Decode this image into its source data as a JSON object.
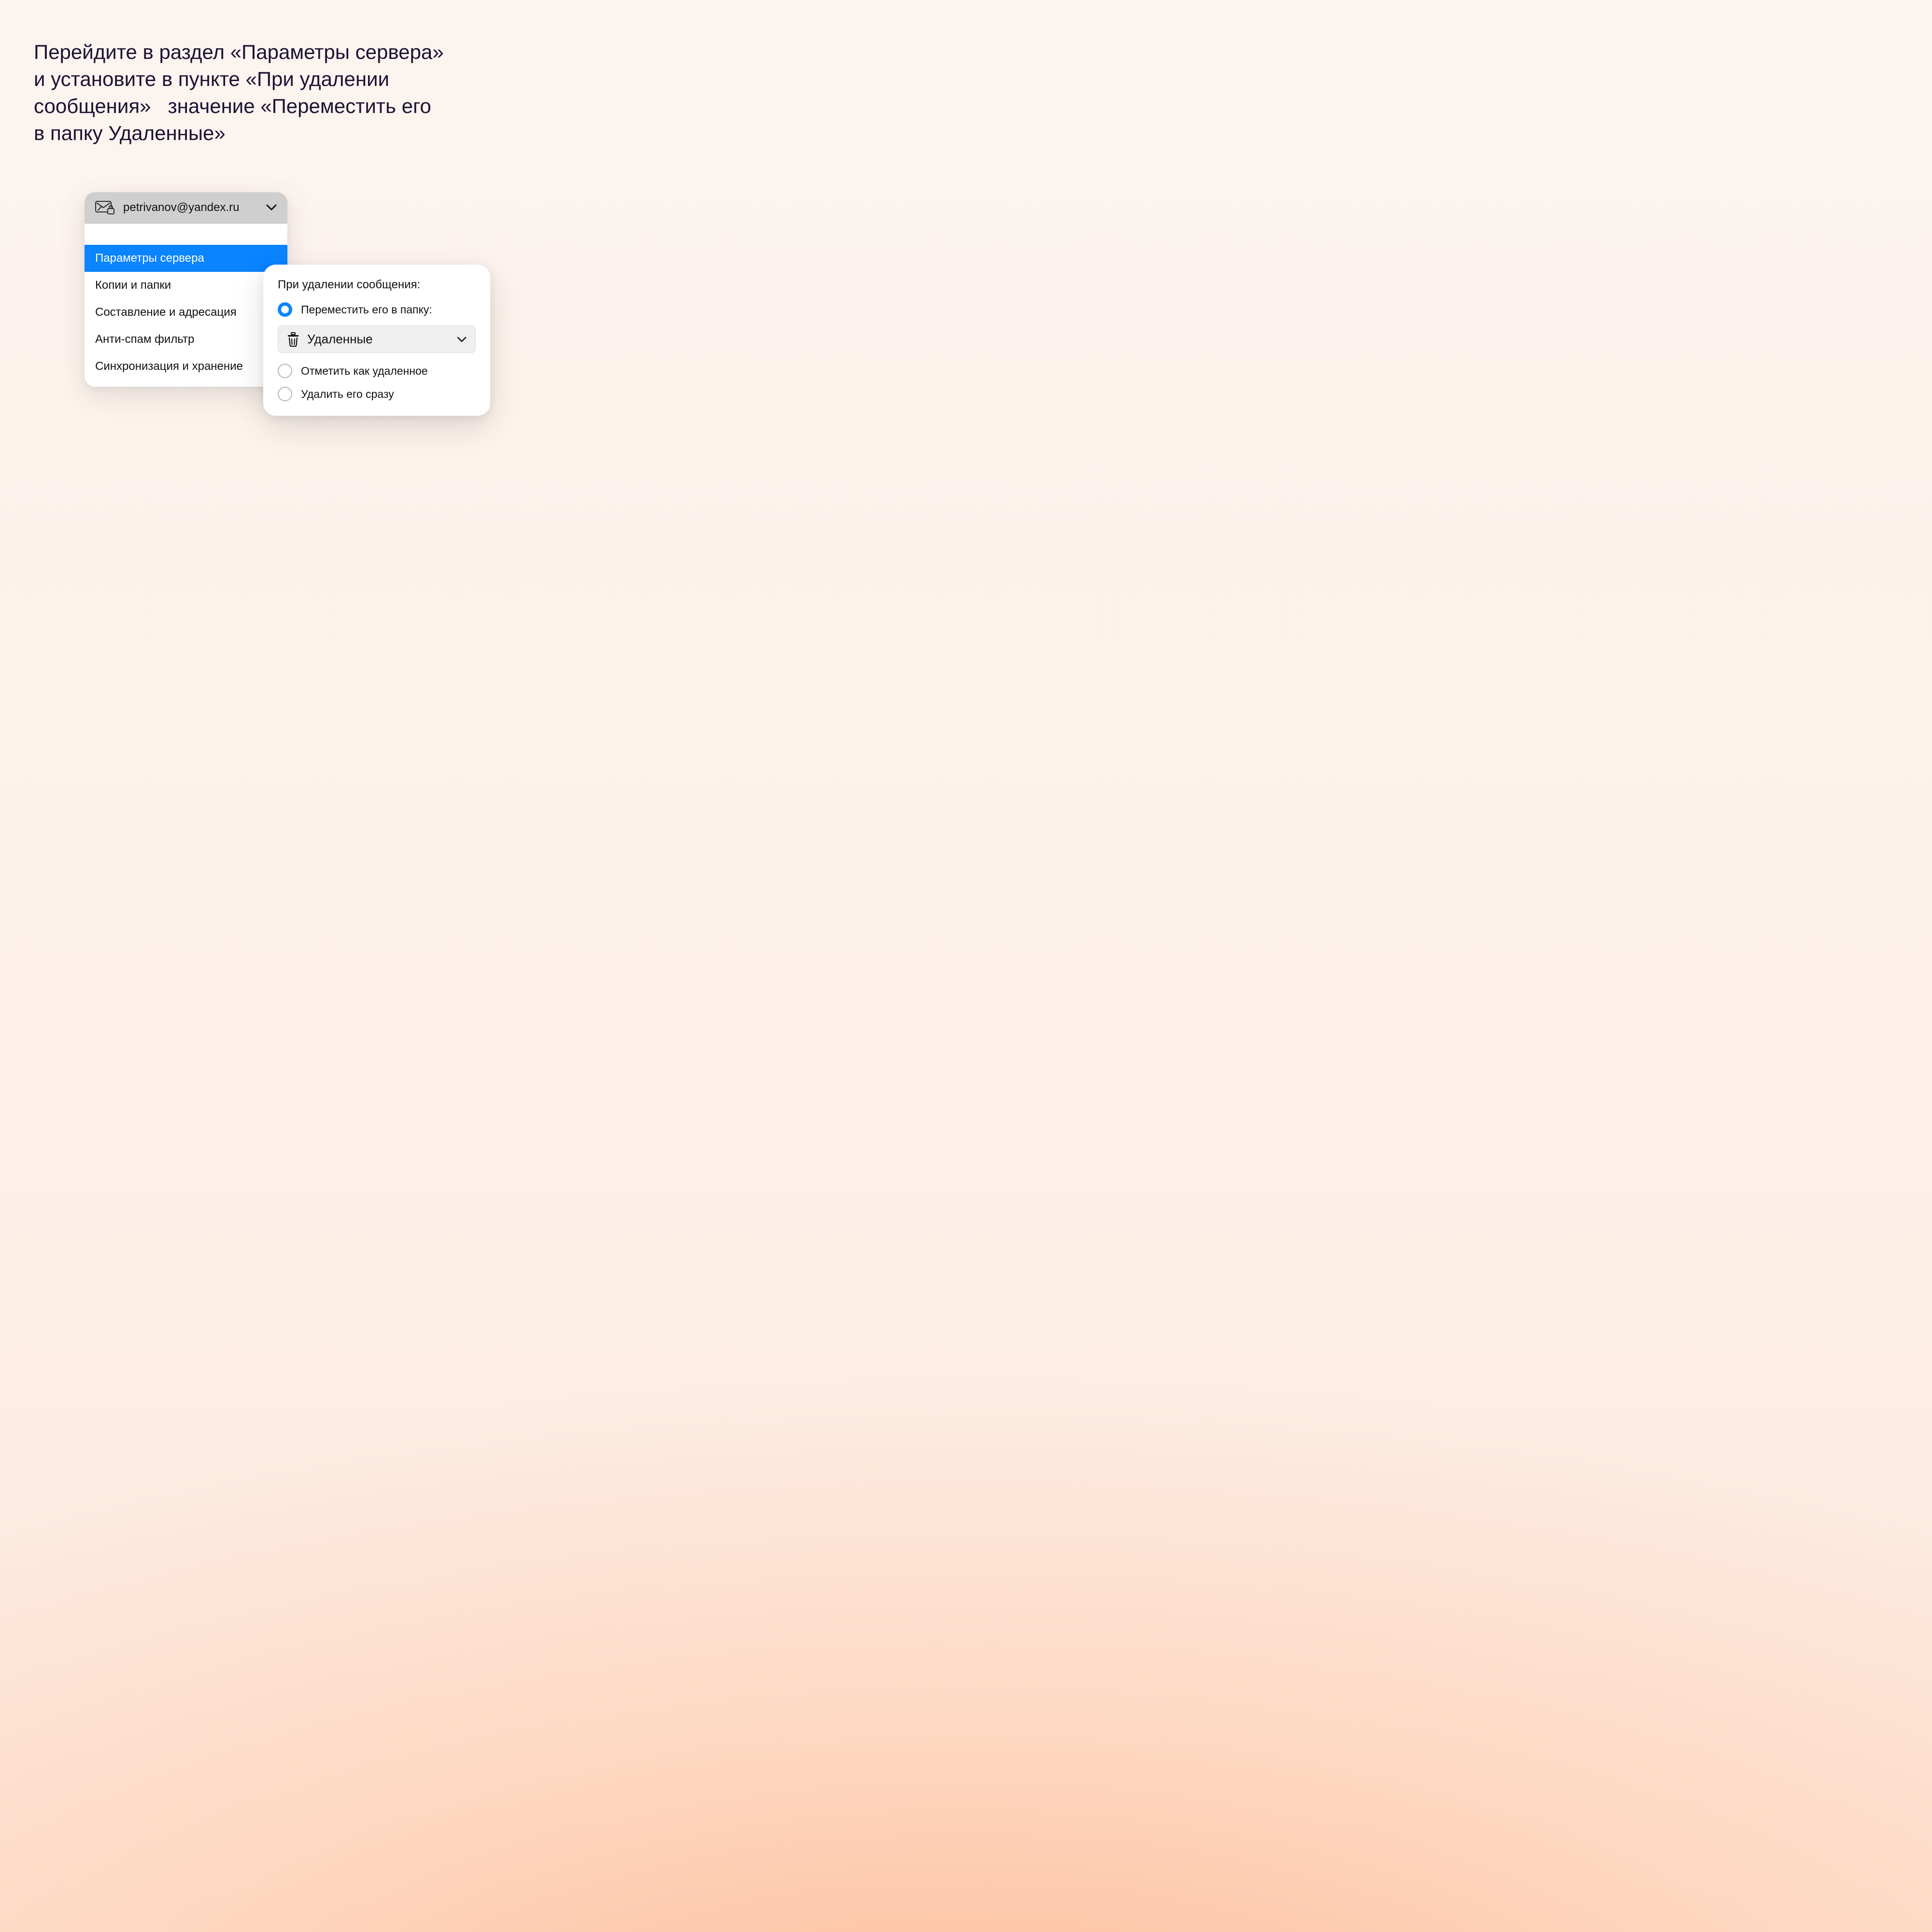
{
  "instruction": "Перейдите в раздел «Параметры сервера» и установите в пункте «При удалении сообщения»   значение «Переместить его в папку Удаленные»",
  "account": {
    "email": "petrivanov@yandex.ru"
  },
  "menu": {
    "items": [
      {
        "label": "Параметры сервера",
        "active": true
      },
      {
        "label": "Копии и папки",
        "active": false
      },
      {
        "label": "Составление и адресация",
        "active": false
      },
      {
        "label": "Анти-спам фильтр",
        "active": false
      },
      {
        "label": "Синхронизация и хранение",
        "active": false
      }
    ]
  },
  "delete_section": {
    "title": "При удалении сообщения:",
    "options": [
      {
        "label": "Переместить его в папку:",
        "selected": true
      },
      {
        "label": "Отметить как удаленное",
        "selected": false
      },
      {
        "label": "Удалить его сразу",
        "selected": false
      }
    ],
    "folder_select": {
      "label": "Удаленные"
    }
  },
  "icons": {
    "mail": "mail-lock-icon",
    "chevron": "chevron-down-icon",
    "trash": "trash-icon"
  }
}
